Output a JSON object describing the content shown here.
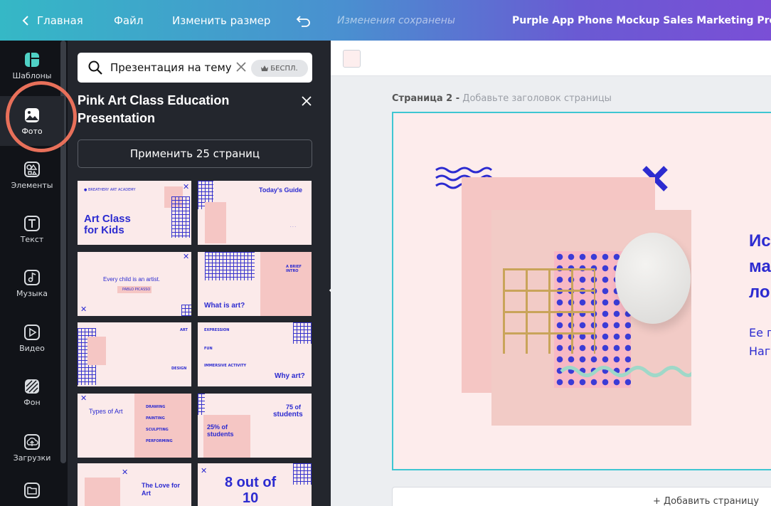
{
  "topbar": {
    "back_label": "Главная",
    "file_label": "Файл",
    "resize_label": "Изменить размер",
    "saved_status": "Изменения сохранены",
    "title": "Purple App Phone Mockup Sales Marketing Present"
  },
  "rail": {
    "items": [
      {
        "label": "Шаблоны",
        "icon": "templates-icon"
      },
      {
        "label": "Фото",
        "icon": "photo-icon"
      },
      {
        "label": "Элементы",
        "icon": "elements-icon"
      },
      {
        "label": "Текст",
        "icon": "text-icon"
      },
      {
        "label": "Музыка",
        "icon": "music-icon"
      },
      {
        "label": "Видео",
        "icon": "video-icon"
      },
      {
        "label": "Фон",
        "icon": "background-icon"
      },
      {
        "label": "Загрузки",
        "icon": "uploads-icon"
      },
      {
        "label": "",
        "icon": "folder-icon"
      }
    ]
  },
  "panel": {
    "search_value": "Презентация на тему",
    "free_badge": "БЕСПЛ.",
    "template_title": "Pink Art Class Education Presentation",
    "apply_button": "Применить 25 страниц",
    "thumbs": {
      "t1_brand": "● BREATHERY ART ACADEMY",
      "t1_title_a": "Art Class",
      "t1_title_b": "for Kids",
      "t2_title": "Today's Guide",
      "t3_title": "Every child is an artist.",
      "t3_sub": "PABLO PICASSO",
      "t4_small": "A BRIEF INTRO",
      "t4_title": "What is art?",
      "t5_a": "ART",
      "t5_b": "DESIGN",
      "t6_a": "EXPRESSION",
      "t6_b": "FUN",
      "t6_c": "IMMERSIVE ACTIVITY",
      "t6_title": "Why art?",
      "t7_title": "Types of Art",
      "t7_items": [
        "DRAWING",
        "PAINTING",
        "SCULPTING",
        "PERFORMING"
      ],
      "t8_a": "75 of",
      "t8_b": "students",
      "t8_c": "25% of",
      "t8_d": "students",
      "t9_title_a": "The Love for",
      "t9_title_b": "Art",
      "t10_a": "8 out of",
      "t10_b": "10"
    }
  },
  "canvas": {
    "page_label": "Страница 2 -",
    "page_placeholder": " Добавьте заголовок страницы",
    "slide_heading": [
      "Ис",
      "ма",
      "ло"
    ],
    "slide_body": [
      "Ее г",
      "Наг"
    ],
    "add_page": "+ Добавить страницу"
  },
  "colors": {
    "accent_blue": "#2c2bd0",
    "slide_bg": "#fdecec",
    "selection": "#3fc6d2",
    "annotation": "#e8705a"
  }
}
